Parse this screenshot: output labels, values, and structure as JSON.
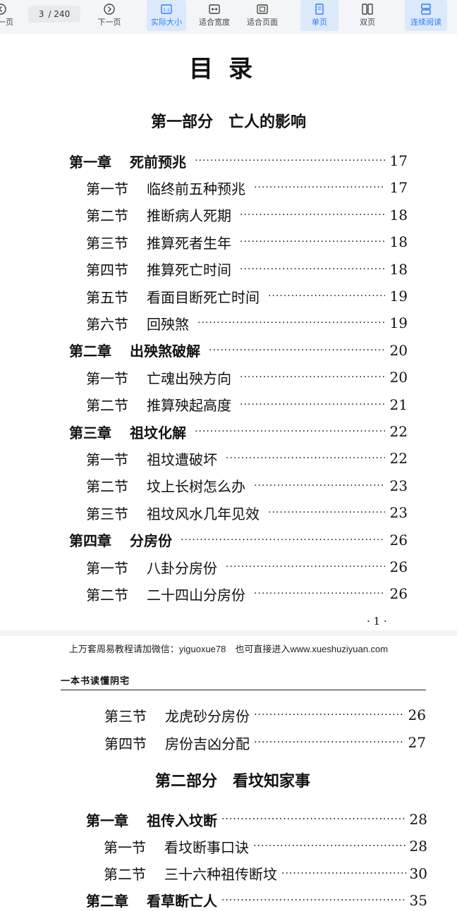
{
  "toolbar": {
    "prev_label": "上一页",
    "page_current": "3",
    "page_total": "/ 240",
    "next_label": "下一页",
    "actual_size_label": "实际大小",
    "fit_width_label": "适合宽度",
    "fit_page_label": "适合页面",
    "single_label": "单页",
    "double_label": "双页",
    "continuous_label": "连续阅读",
    "accent": "#2f7cf6"
  },
  "page1": {
    "title": "目录",
    "part_title": "第一部分　亡人的影响",
    "entries": [
      {
        "type": "chapter",
        "label": "第一章",
        "name": "死前预兆",
        "page": "17"
      },
      {
        "type": "section",
        "label": "第一节",
        "name": "临终前五种预兆",
        "page": "17"
      },
      {
        "type": "section",
        "label": "第二节",
        "name": "推断病人死期",
        "page": "18"
      },
      {
        "type": "section",
        "label": "第三节",
        "name": "推算死者生年",
        "page": "18"
      },
      {
        "type": "section",
        "label": "第四节",
        "name": "推算死亡时间",
        "page": "18"
      },
      {
        "type": "section",
        "label": "第五节",
        "name": "看面目断死亡时间",
        "page": "19"
      },
      {
        "type": "section",
        "label": "第六节",
        "name": "回殃煞",
        "page": "19"
      },
      {
        "type": "chapter",
        "label": "第二章",
        "name": "出殃煞破解",
        "page": "20"
      },
      {
        "type": "section",
        "label": "第一节",
        "name": "亡魂出殃方向",
        "page": "20"
      },
      {
        "type": "section",
        "label": "第二节",
        "name": "推算殃起高度",
        "page": "21"
      },
      {
        "type": "chapter",
        "label": "第三章",
        "name": "祖坟化解",
        "page": "22"
      },
      {
        "type": "section",
        "label": "第一节",
        "name": "祖坟遭破坏",
        "page": "22"
      },
      {
        "type": "section",
        "label": "第二节",
        "name": "坟上长树怎么办",
        "page": "23"
      },
      {
        "type": "section",
        "label": "第三节",
        "name": "祖坟风水几年见效",
        "page": "23"
      },
      {
        "type": "chapter",
        "label": "第四章",
        "name": "分房份",
        "page": "26"
      },
      {
        "type": "section",
        "label": "第一节",
        "name": "八卦分房份",
        "page": "26"
      },
      {
        "type": "section",
        "label": "第二节",
        "name": "二十四山分房份",
        "page": "26"
      }
    ],
    "page_number": "· 1 ·"
  },
  "banner": "上万套周易教程请加微信：yiguoxue78　也可直接进入www.xueshuziyuan.com",
  "page2": {
    "running_header": "一本书读懂阴宅",
    "entries_a": [
      {
        "type": "section",
        "label": "第三节",
        "name": "龙虎砂分房份",
        "page": "26"
      },
      {
        "type": "section",
        "label": "第四节",
        "name": "房份吉凶分配",
        "page": "27"
      }
    ],
    "part_title": "第二部分　看坟知家事",
    "entries_b": [
      {
        "type": "chapter",
        "label": "第一章",
        "name": "祖传入坟断",
        "page": "28"
      },
      {
        "type": "section",
        "label": "第一节",
        "name": "看坟断事口诀",
        "page": "28"
      },
      {
        "type": "section",
        "label": "第二节",
        "name": "三十六种祖传断坟",
        "page": "30"
      },
      {
        "type": "chapter",
        "label": "第二章",
        "name": "看草断亡人",
        "page": "35"
      }
    ]
  }
}
